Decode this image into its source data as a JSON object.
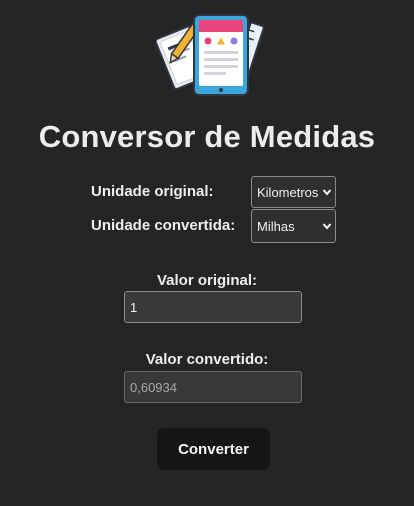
{
  "app": {
    "title": "Conversor de Medidas"
  },
  "form": {
    "unidade_original_label": "Unidade original:",
    "unidade_original_value": "Kilometros",
    "unidade_convertida_label": "Unidade convertida:",
    "unidade_convertida_value": "Milhas",
    "valor_original_label": "Valor original:",
    "valor_original_value": "1",
    "valor_convertido_label": "Valor convertido:",
    "valor_convertido_value": "0,60934",
    "converter_label": "Converter"
  },
  "icons": {
    "logo": "measuring-tools-icon",
    "select_arrow": "chevron-down-icon"
  },
  "colors": {
    "background": "#252525",
    "button": "#161616",
    "text": "#eeeeee"
  }
}
